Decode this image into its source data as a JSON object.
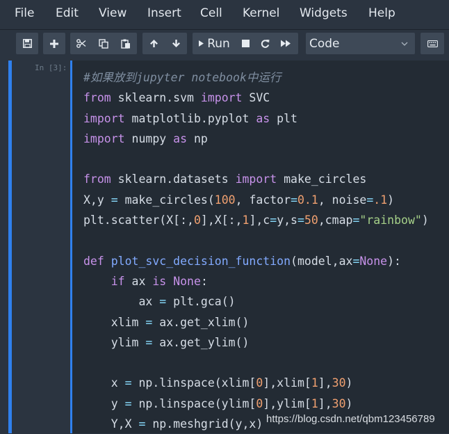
{
  "menu": {
    "items": [
      {
        "label": "File"
      },
      {
        "label": "Edit"
      },
      {
        "label": "View"
      },
      {
        "label": "Insert"
      },
      {
        "label": "Cell"
      },
      {
        "label": "Kernel"
      },
      {
        "label": "Widgets"
      },
      {
        "label": "Help"
      }
    ]
  },
  "toolbar": {
    "run_label": "Run",
    "cell_type": "Code",
    "icons": [
      "save-icon",
      "plus-icon",
      "cut-icon",
      "copy-icon",
      "paste-icon",
      "arrow-up-icon",
      "arrow-down-icon",
      "run-icon",
      "stop-icon",
      "restart-icon",
      "fast-forward-icon",
      "chevron-down-icon",
      "keyboard-icon"
    ]
  },
  "cell": {
    "prompt": "In [3]:",
    "lines": [
      [
        {
          "t": "#如果放到jupyter notebook中运行",
          "c": "comment"
        }
      ],
      [
        {
          "t": "from",
          "c": "kw"
        },
        {
          "t": " sklearn.svm ",
          "c": ""
        },
        {
          "t": "import",
          "c": "kw"
        },
        {
          "t": " SVC",
          "c": ""
        }
      ],
      [
        {
          "t": "import",
          "c": "kw"
        },
        {
          "t": " matplotlib.pyplot ",
          "c": ""
        },
        {
          "t": "as",
          "c": "kw"
        },
        {
          "t": " plt",
          "c": ""
        }
      ],
      [
        {
          "t": "import",
          "c": "kw"
        },
        {
          "t": " numpy ",
          "c": ""
        },
        {
          "t": "as",
          "c": "kw"
        },
        {
          "t": " np",
          "c": ""
        }
      ],
      [
        {
          "t": "",
          "c": ""
        }
      ],
      [
        {
          "t": "from",
          "c": "kw"
        },
        {
          "t": " sklearn.datasets ",
          "c": ""
        },
        {
          "t": "import",
          "c": "kw"
        },
        {
          "t": " make_circles",
          "c": ""
        }
      ],
      [
        {
          "t": "X,y ",
          "c": ""
        },
        {
          "t": "=",
          "c": "op"
        },
        {
          "t": " make_circles(",
          "c": ""
        },
        {
          "t": "100",
          "c": "num"
        },
        {
          "t": ", factor",
          "c": ""
        },
        {
          "t": "=",
          "c": "op"
        },
        {
          "t": "0.1",
          "c": "num"
        },
        {
          "t": ", noise",
          "c": ""
        },
        {
          "t": "=",
          "c": "op"
        },
        {
          "t": ".1",
          "c": "num"
        },
        {
          "t": ")",
          "c": ""
        }
      ],
      [
        {
          "t": "plt.scatter(X[:,",
          "c": ""
        },
        {
          "t": "0",
          "c": "num"
        },
        {
          "t": "],X[:,",
          "c": ""
        },
        {
          "t": "1",
          "c": "num"
        },
        {
          "t": "],c",
          "c": ""
        },
        {
          "t": "=",
          "c": "op"
        },
        {
          "t": "y,s",
          "c": ""
        },
        {
          "t": "=",
          "c": "op"
        },
        {
          "t": "50",
          "c": "num"
        },
        {
          "t": ",cmap",
          "c": ""
        },
        {
          "t": "=",
          "c": "op"
        },
        {
          "t": "\"rainbow\"",
          "c": "str"
        },
        {
          "t": ")",
          "c": ""
        }
      ],
      [
        {
          "t": "",
          "c": ""
        }
      ],
      [
        {
          "t": "def",
          "c": "kw"
        },
        {
          "t": " ",
          "c": ""
        },
        {
          "t": "plot_svc_decision_function",
          "c": "fn"
        },
        {
          "t": "(model,ax",
          "c": ""
        },
        {
          "t": "=",
          "c": "op"
        },
        {
          "t": "None",
          "c": "kw"
        },
        {
          "t": "):",
          "c": ""
        }
      ],
      [
        {
          "t": "    ",
          "c": ""
        },
        {
          "t": "if",
          "c": "kw"
        },
        {
          "t": " ax ",
          "c": ""
        },
        {
          "t": "is",
          "c": "kw"
        },
        {
          "t": " ",
          "c": ""
        },
        {
          "t": "None",
          "c": "kw"
        },
        {
          "t": ":",
          "c": ""
        }
      ],
      [
        {
          "t": "        ax ",
          "c": ""
        },
        {
          "t": "=",
          "c": "op"
        },
        {
          "t": " plt.gca()",
          "c": ""
        }
      ],
      [
        {
          "t": "    xlim ",
          "c": ""
        },
        {
          "t": "=",
          "c": "op"
        },
        {
          "t": " ax.get_xlim()",
          "c": ""
        }
      ],
      [
        {
          "t": "    ylim ",
          "c": ""
        },
        {
          "t": "=",
          "c": "op"
        },
        {
          "t": " ax.get_ylim()",
          "c": ""
        }
      ],
      [
        {
          "t": "",
          "c": ""
        }
      ],
      [
        {
          "t": "    x ",
          "c": ""
        },
        {
          "t": "=",
          "c": "op"
        },
        {
          "t": " np.linspace(xlim[",
          "c": ""
        },
        {
          "t": "0",
          "c": "num"
        },
        {
          "t": "],xlim[",
          "c": ""
        },
        {
          "t": "1",
          "c": "num"
        },
        {
          "t": "],",
          "c": ""
        },
        {
          "t": "30",
          "c": "num"
        },
        {
          "t": ")",
          "c": ""
        }
      ],
      [
        {
          "t": "    y ",
          "c": ""
        },
        {
          "t": "=",
          "c": "op"
        },
        {
          "t": " np.linspace(ylim[",
          "c": ""
        },
        {
          "t": "0",
          "c": "num"
        },
        {
          "t": "],ylim[",
          "c": ""
        },
        {
          "t": "1",
          "c": "num"
        },
        {
          "t": "],",
          "c": ""
        },
        {
          "t": "30",
          "c": "num"
        },
        {
          "t": ")",
          "c": ""
        }
      ],
      [
        {
          "t": "    Y,X ",
          "c": ""
        },
        {
          "t": "=",
          "c": "op"
        },
        {
          "t": " np.meshgrid(y,x)",
          "c": ""
        }
      ]
    ]
  },
  "watermark": "https://blog.csdn.net/qbm123456789",
  "colors": {
    "background": "#2b3440",
    "editor": "#232b34",
    "accent": "#2f80ed",
    "keyword": "#c792ea",
    "number": "#f0a070",
    "string": "#a6d189"
  }
}
